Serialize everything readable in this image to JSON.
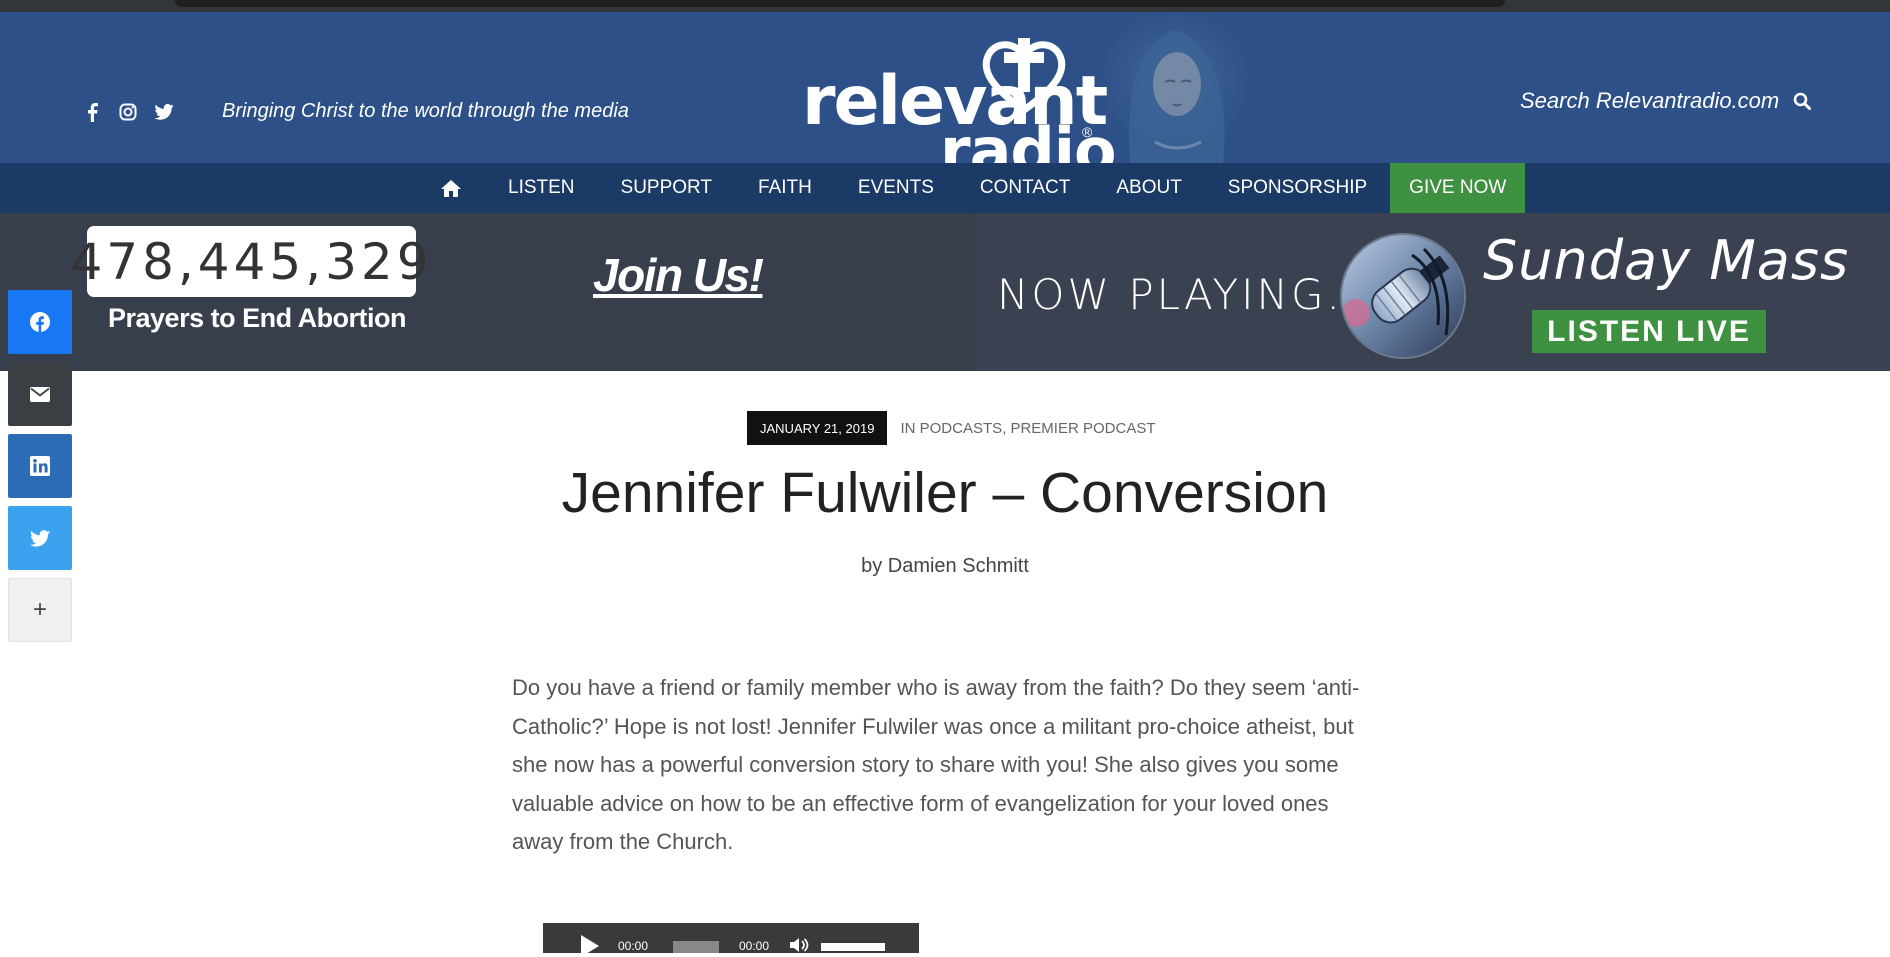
{
  "header": {
    "tagline": "Bringing Christ to the world through the media",
    "logo_word_1": "relevant",
    "logo_word_2": "radio",
    "logo_mark": "®",
    "search_label": "Search Relevantradio.com",
    "social_icons": [
      "facebook-icon",
      "instagram-icon",
      "twitter-icon"
    ]
  },
  "nav": {
    "home_icon": "home-icon",
    "items": [
      "LISTEN",
      "SUPPORT",
      "FAITH",
      "EVENTS",
      "CONTACT",
      "ABOUT",
      "SPONSORSHIP"
    ],
    "give_label": "GIVE NOW"
  },
  "banner": {
    "counter": "478,445,329",
    "counter_caption": "Prayers to End Abortion",
    "join": "Join Us!",
    "now_playing": "NOW PLAYING...",
    "show": "Sunday Mass",
    "listen_live": "LISTEN LIVE"
  },
  "share": [
    "facebook-icon",
    "email-icon",
    "linkedin-icon",
    "twitter-icon",
    "plus-icon"
  ],
  "share_more_glyph": "+",
  "article": {
    "date": "JANUARY 21, 2019",
    "in_label": "IN",
    "category_1": "PODCASTS",
    "category_sep": ", ",
    "category_2": "PREMIER PODCAST",
    "title": "Jennifer Fulwiler – Conversion",
    "by_label": "by",
    "author": "Damien Schmitt",
    "body": "Do you have a friend or family member who is away from the faith? Do they seem ‘anti-Catholic?’ Hope is not lost! Jennifer Fulwiler was once a militant pro-choice atheist, but she now has a powerful conversion story to share with you! She also gives you some valuable advice on how to be an effective form of evangelization for your loved ones away from the Church."
  },
  "player": {
    "current_time": "00:00",
    "duration": "00:00"
  },
  "colors": {
    "header_blue": "#2c5087",
    "nav_blue": "#1b3b66",
    "banner_gray": "#373f4c",
    "give_green": "#3d9140"
  }
}
